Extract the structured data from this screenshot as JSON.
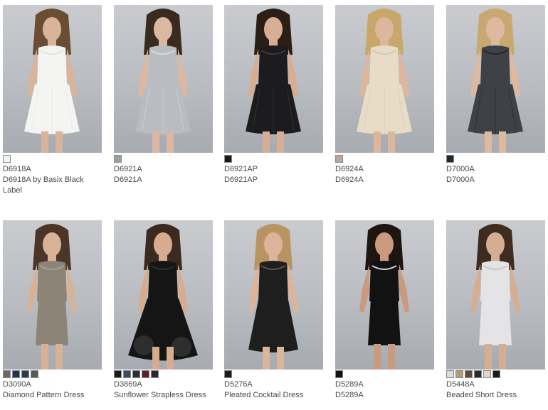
{
  "products": [
    {
      "code": "D6918A",
      "name": "D6918A by Basix Black Label",
      "dress_color": "#f4f4f2",
      "accent": "#e6e3dc",
      "swatches": [
        "#f2f2f2"
      ],
      "skin": "#d9b39a",
      "hair": "#6b4d33"
    },
    {
      "code": "D6921A",
      "name": "D6921A",
      "dress_color": "#b9bdc2",
      "accent": "#d9dade",
      "swatches": [
        "#9aa0a6"
      ],
      "skin": "#dcb7a2",
      "hair": "#3a2b20"
    },
    {
      "code": "D6921AP",
      "name": "D6921AP",
      "dress_color": "#1c1c1e",
      "accent": "#3a3a3c",
      "swatches": [
        "#1a1a1a"
      ],
      "skin": "#d7ae94",
      "hair": "#2a1e16"
    },
    {
      "code": "D6924A",
      "name": "D6924A",
      "dress_color": "#e8dcc6",
      "accent": "#cfc7bd",
      "swatches": [
        "#b8a89a"
      ],
      "skin": "#dcb79e",
      "hair": "#c9a66a"
    },
    {
      "code": "D7000A",
      "name": "D7000A",
      "dress_color": "#3e4145",
      "accent": "#23262a",
      "swatches": [
        "#222830"
      ],
      "skin": "#ddb9a0",
      "hair": "#c8a870"
    },
    {
      "code": "D3090A",
      "name": "Diamond Pattern Dress",
      "dress_color": "#8c8577",
      "accent": "#a69f91",
      "swatches": [
        "#6a6660",
        "#1f3352",
        "#2b3a4e",
        "#585c52"
      ],
      "skin": "#d8b297",
      "hair": "#4a3526"
    },
    {
      "code": "D3869A",
      "name": "Sunflower Strapless Dress",
      "dress_color": "#151515",
      "accent": "#2e2e2e",
      "swatches": [
        "#1a1a1a",
        "#3b4a63",
        "#2b2e3b",
        "#5a1f28",
        "#2d2430"
      ],
      "skin": "#d6ab90",
      "hair": "#3b2a1f"
    },
    {
      "code": "D5276A",
      "name": "Pleated Cocktail Dress",
      "dress_color": "#1e1e1f",
      "accent": "#55534f",
      "swatches": [
        "#1a1a1a"
      ],
      "skin": "#dbb49a",
      "hair": "#b89463"
    },
    {
      "code": "D5289A",
      "name": "D5289A",
      "dress_color": "#121212",
      "accent": "#cfcfcf",
      "swatches": [
        "#111111"
      ],
      "skin": "#c99a7e",
      "hair": "#1e1410"
    },
    {
      "code": "D5448A",
      "name": "Beaded Short Dress",
      "dress_color": "#e4e4e6",
      "accent": "#c9c9cc",
      "swatches": [
        "#dcdcdc",
        "#b59a76",
        "#5f4a36",
        "#2a2a2a",
        "#e6d3d0",
        "#1a1a1a"
      ],
      "skin": "#d5ad93",
      "hair": "#3e2c20"
    }
  ]
}
